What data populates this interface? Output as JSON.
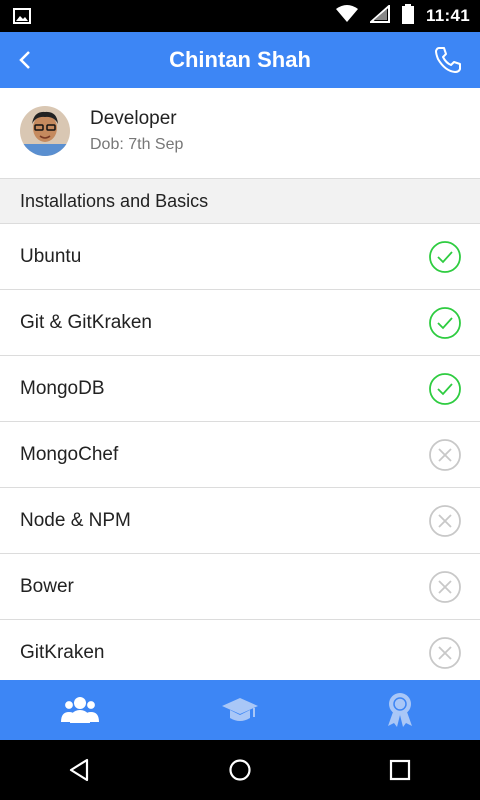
{
  "status_bar": {
    "time": "11:41",
    "icons": [
      "image-icon",
      "wifi-icon",
      "signal-icon",
      "battery-icon"
    ]
  },
  "app_bar": {
    "title": "Chintan Shah",
    "back_icon": "back-arrow-icon",
    "call_icon": "phone-icon"
  },
  "profile": {
    "role": "Developer",
    "dob": "Dob: 7th Sep"
  },
  "section": {
    "title": "Installations and Basics"
  },
  "items": [
    {
      "label": "Ubuntu",
      "status": "done"
    },
    {
      "label": "Git & GitKraken",
      "status": "done"
    },
    {
      "label": "MongoDB",
      "status": "done"
    },
    {
      "label": "MongoChef",
      "status": "pending"
    },
    {
      "label": "Node & NPM",
      "status": "pending"
    },
    {
      "label": "Bower",
      "status": "pending"
    },
    {
      "label": "GitKraken",
      "status": "pending"
    }
  ],
  "bottom_nav": {
    "tabs": [
      "people-icon",
      "graduation-cap-icon",
      "award-icon"
    ],
    "active": 0
  },
  "colors": {
    "primary": "#3d86f5",
    "done": "#2ecc40",
    "pending": "#c8c8c8"
  }
}
